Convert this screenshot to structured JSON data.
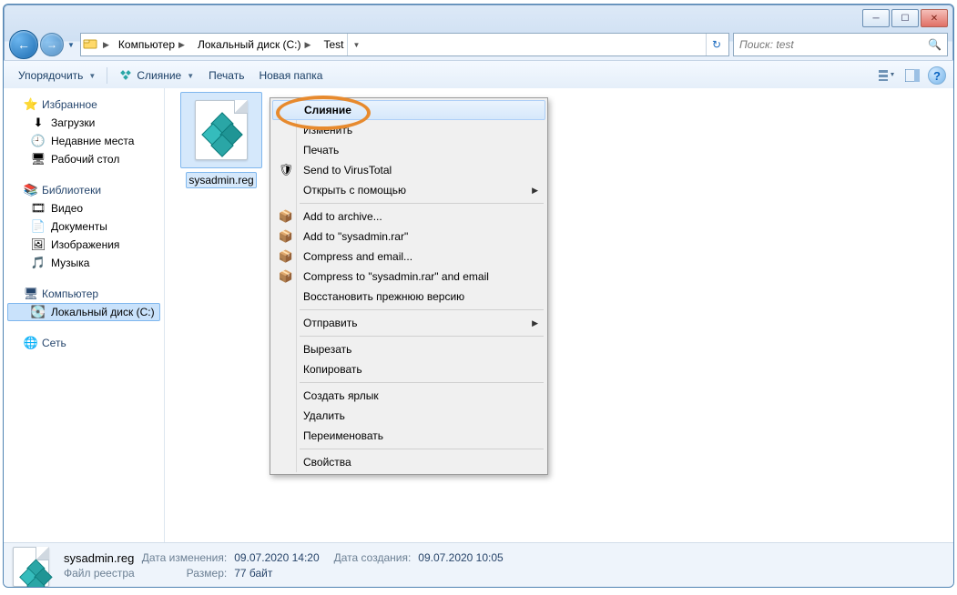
{
  "window": {
    "min_label": "_",
    "max_label": "▢",
    "close_label": "✕"
  },
  "nav": {
    "back": "←",
    "forward": "→"
  },
  "breadcrumb": {
    "root_icon": "🖥",
    "items": [
      "Компьютер",
      "Локальный диск (C:)",
      "Test"
    ]
  },
  "search": {
    "placeholder": "Поиск: test",
    "icon": "🔍"
  },
  "toolbar": {
    "organize": "Упорядочить",
    "merge": "Слияние",
    "print": "Печать",
    "new_folder": "Новая папка",
    "help": "?"
  },
  "navpane": {
    "favorites": {
      "title": "Избранное",
      "items": [
        "Загрузки",
        "Недавние места",
        "Рабочий стол"
      ],
      "icons": [
        "⬇",
        "🕘",
        "🖥"
      ]
    },
    "libraries": {
      "title": "Библиотеки",
      "items": [
        "Видео",
        "Документы",
        "Изображения",
        "Музыка"
      ],
      "icons": [
        "🎞",
        "📄",
        "🖼",
        "🎵"
      ]
    },
    "computer": {
      "title": "Компьютер",
      "items": [
        "Локальный диск (C:)"
      ],
      "icons": [
        "💽"
      ]
    },
    "network": {
      "title": "Сеть"
    }
  },
  "file": {
    "name": "sysadmin.reg"
  },
  "context_menu": {
    "items": [
      {
        "label": "Слияние",
        "bold": true,
        "highlight": true
      },
      {
        "label": "Изменить"
      },
      {
        "label": "Печать"
      },
      {
        "label": "Send to VirusTotal",
        "icon": "🛡"
      },
      {
        "label": "Открыть с помощью",
        "submenu": true
      },
      {
        "sep": true
      },
      {
        "label": "Add to archive...",
        "icon": "📦"
      },
      {
        "label": "Add to \"sysadmin.rar\"",
        "icon": "📦"
      },
      {
        "label": "Compress and email...",
        "icon": "📦"
      },
      {
        "label": "Compress to \"sysadmin.rar\" and email",
        "icon": "📦"
      },
      {
        "label": "Восстановить прежнюю версию"
      },
      {
        "sep": true
      },
      {
        "label": "Отправить",
        "submenu": true
      },
      {
        "sep": true
      },
      {
        "label": "Вырезать"
      },
      {
        "label": "Копировать"
      },
      {
        "sep": true
      },
      {
        "label": "Создать ярлык"
      },
      {
        "label": "Удалить"
      },
      {
        "label": "Переименовать"
      },
      {
        "sep": true
      },
      {
        "label": "Свойства"
      }
    ]
  },
  "details": {
    "name": "sysadmin.reg",
    "type": "Файл реестра",
    "mod_label": "Дата изменения:",
    "mod_value": "09.07.2020 14:20",
    "created_label": "Дата создания:",
    "created_value": "09.07.2020 10:05",
    "size_label": "Размер:",
    "size_value": "77 байт"
  }
}
